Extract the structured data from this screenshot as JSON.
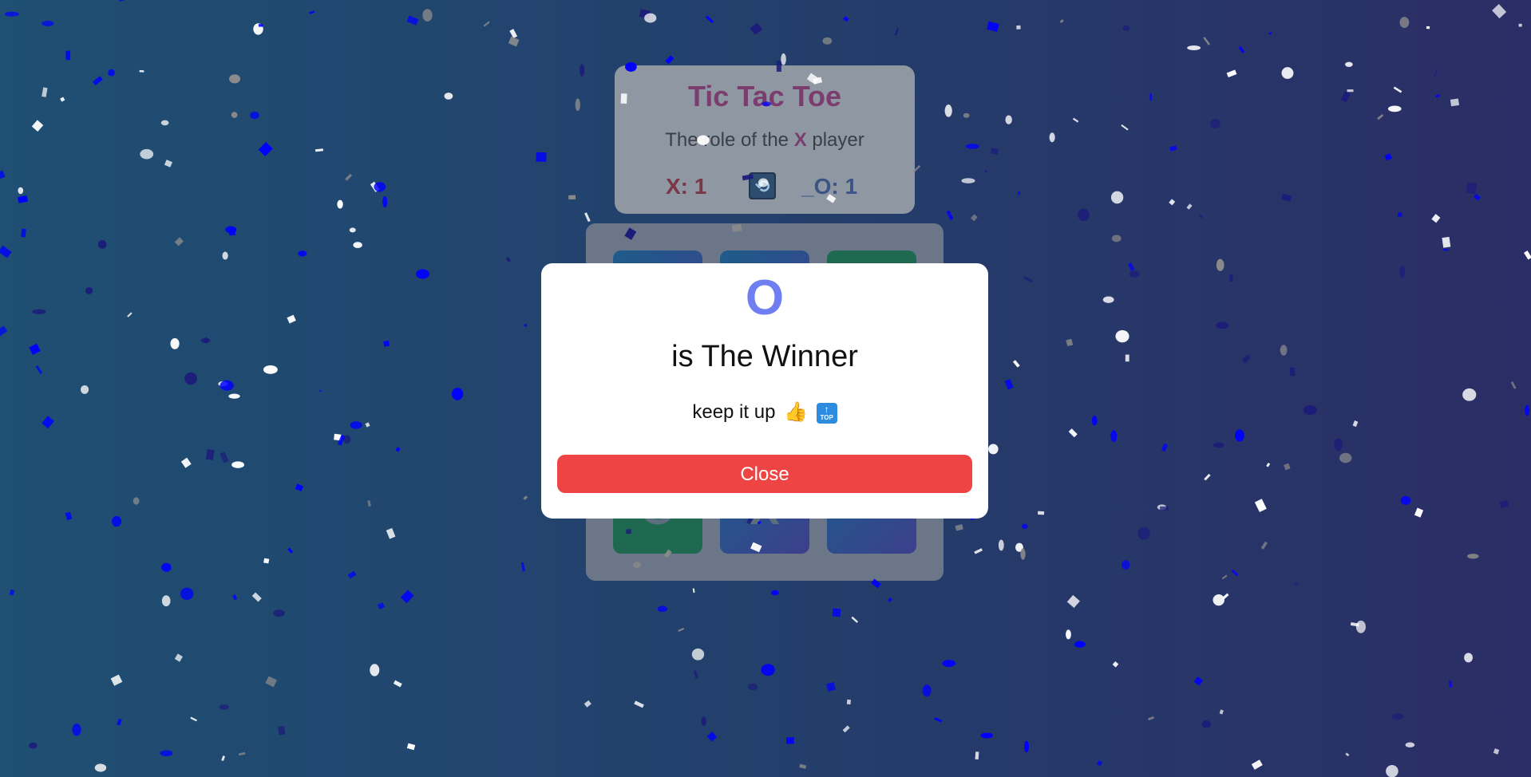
{
  "game": {
    "title": "Tic Tac Toe",
    "turn_prefix": "The role of the ",
    "turn_player": "X",
    "turn_suffix": " player",
    "score_x": "X: 1",
    "score_o": "_O: 1",
    "reset_icon": "⟲",
    "board": [
      {
        "value": "",
        "style": "blue"
      },
      {
        "value": "",
        "style": "blue"
      },
      {
        "value": "",
        "style": "green"
      },
      {
        "value": "",
        "style": "blue"
      },
      {
        "value": "",
        "style": "blue"
      },
      {
        "value": "",
        "style": "blue"
      },
      {
        "value": "O",
        "style": "green"
      },
      {
        "value": "X",
        "style": "blue"
      },
      {
        "value": "",
        "style": "blue"
      }
    ]
  },
  "modal": {
    "winner_symbol": "O",
    "winner_text": "is The Winner",
    "keep_text": "keep it up",
    "thumb_icon": "👍",
    "top_icon_label": "TOP",
    "close_label": "Close"
  },
  "colors": {
    "close_button": "#ef4444",
    "winner_symbol": "#6f7ff2",
    "background_left": "#1f4f73",
    "background_right": "#2b2e66"
  }
}
